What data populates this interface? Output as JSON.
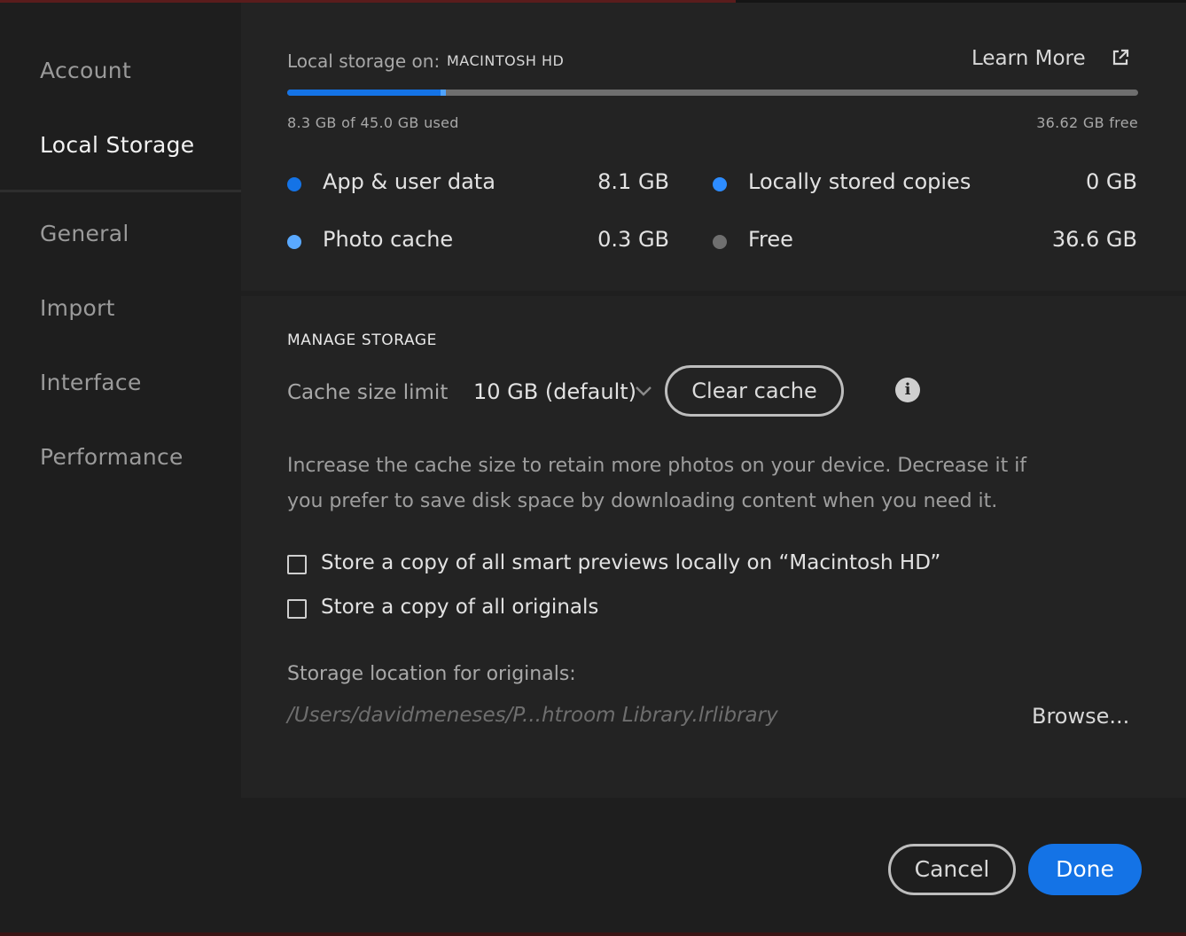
{
  "sidebar": {
    "items": [
      {
        "label": "Account",
        "active": false
      },
      {
        "label": "Local Storage",
        "active": true
      },
      {
        "label": "General",
        "active": false
      },
      {
        "label": "Import",
        "active": false
      },
      {
        "label": "Interface",
        "active": false
      },
      {
        "label": "Performance",
        "active": false
      }
    ]
  },
  "storage": {
    "local_label": "Local storage on:",
    "volume": "MACINTOSH HD",
    "learn_more": "Learn More",
    "used_text": "8.3 GB of 45.0 GB used",
    "free_text": "36.62 GB free",
    "usage": {
      "app_user_gb": 8.1,
      "photo_cache_gb": 0.3,
      "total_gb": 45.0
    },
    "legend": [
      {
        "label": "App & user data",
        "value": "8.1 GB",
        "color": "#1473e6"
      },
      {
        "label": "Locally stored copies",
        "value": "0 GB",
        "color": "#2d8cff"
      },
      {
        "label": "Photo cache",
        "value": "0.3 GB",
        "color": "#5aa9ff"
      },
      {
        "label": "Free",
        "value": "36.6 GB",
        "color": "#6f6f6f"
      }
    ]
  },
  "manage": {
    "title": "MANAGE STORAGE",
    "cache_label": "Cache size limit",
    "cache_value": "10 GB (default)",
    "clear_cache": "Clear cache",
    "description": "Increase the cache size to retain more photos on your device. Decrease it if you prefer to save disk space by downloading content when you need it.",
    "options": [
      {
        "label": "Store a copy of all smart previews locally on “Macintosh HD”",
        "checked": false
      },
      {
        "label": "Store a copy of all originals",
        "checked": false
      }
    ],
    "location_label": "Storage location for originals:",
    "location_path": "/Users/davidmeneses/P...htroom Library.lrlibrary",
    "browse": "Browse..."
  },
  "footer": {
    "cancel": "Cancel",
    "done": "Done"
  },
  "colors": {
    "accent": "#1473e6",
    "background": "#1e1e1e",
    "panel": "#232323"
  }
}
